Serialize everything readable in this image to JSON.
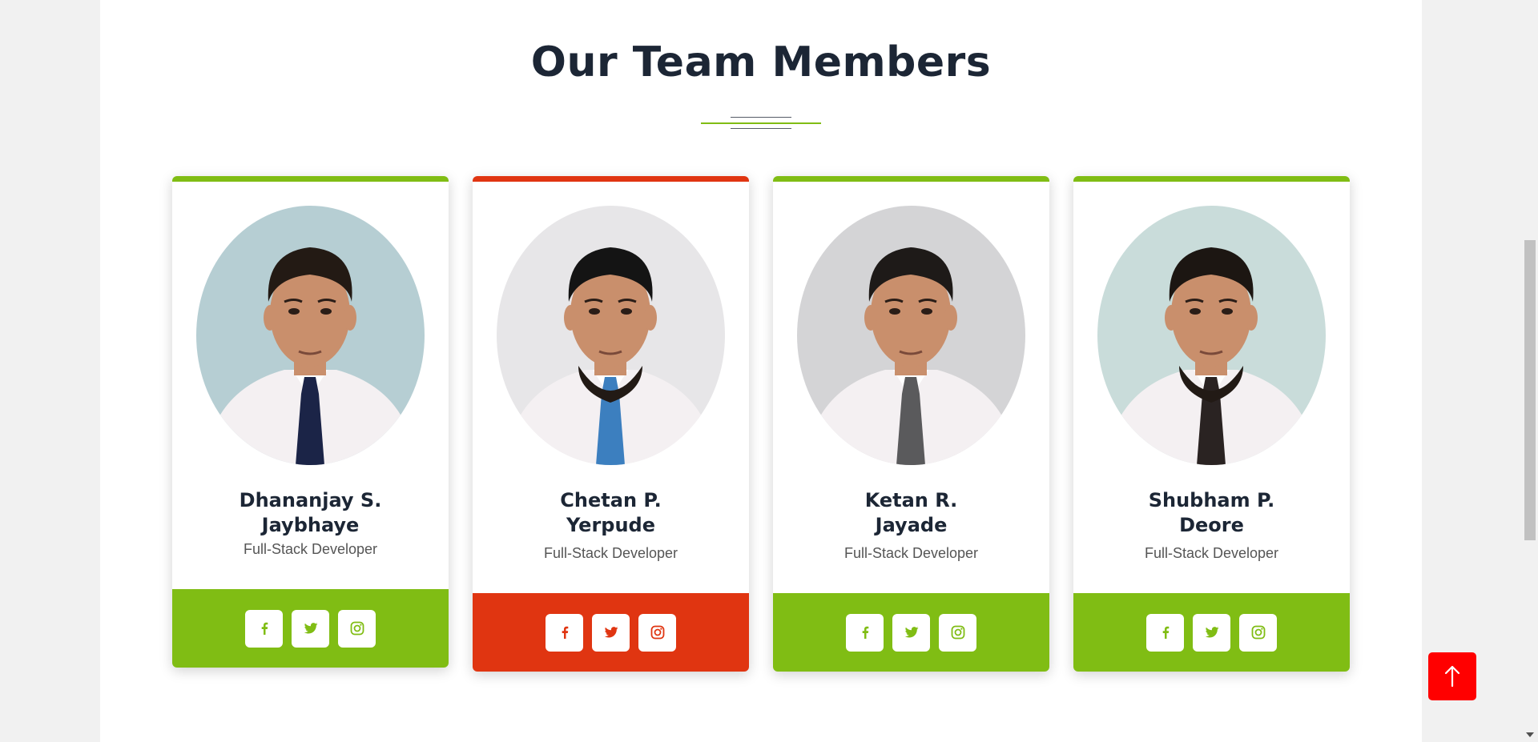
{
  "section": {
    "title": "Our Team Members"
  },
  "colors": {
    "green": "#80bd14",
    "red": "#e03511",
    "to_top": "#ff0000"
  },
  "members": [
    {
      "name_line1": "Dhananjay S.",
      "name_line2": "Jaybhaye",
      "role": "Full-Stack Developer",
      "accent": "#80bd14",
      "photo_bg": "#b6ced3",
      "tie": "#1b2447",
      "hair": "#231a14",
      "beard": false,
      "social": [
        "facebook-icon",
        "twitter-icon",
        "instagram-icon"
      ]
    },
    {
      "name_line1": "Chetan P.",
      "name_line2": "Yerpude",
      "role": "Full-Stack Developer",
      "accent": "#e03511",
      "photo_bg": "#e7e6e8",
      "tie": "#3c7fbf",
      "hair": "#141414",
      "beard": true,
      "social": [
        "facebook-icon",
        "twitter-icon",
        "instagram-icon"
      ]
    },
    {
      "name_line1": "Ketan R.",
      "name_line2": "Jayade",
      "role": "Full-Stack Developer",
      "accent": "#80bd14",
      "photo_bg": "#d4d4d6",
      "tie": "#5a5a5c",
      "hair": "#1e1a18",
      "beard": false,
      "social": [
        "facebook-icon",
        "twitter-icon",
        "instagram-icon"
      ]
    },
    {
      "name_line1": "Shubham P.",
      "name_line2": "Deore",
      "role": "Full-Stack Developer",
      "accent": "#80bd14",
      "photo_bg": "#c9dcda",
      "tie": "#2a2322",
      "hair": "#1c1612",
      "beard": true,
      "social": [
        "facebook-icon",
        "twitter-icon",
        "instagram-icon"
      ]
    }
  ]
}
